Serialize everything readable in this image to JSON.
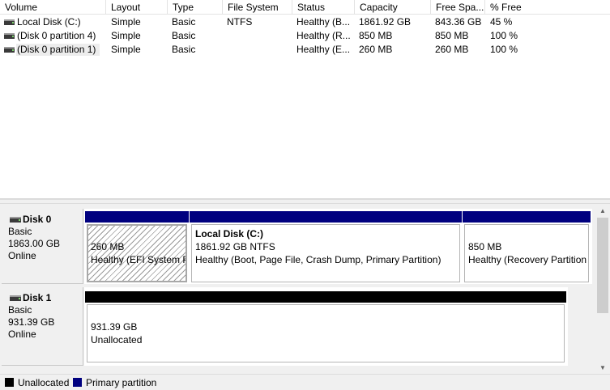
{
  "volume_list": {
    "columns": [
      "Volume",
      "Layout",
      "Type",
      "File System",
      "Status",
      "Capacity",
      "Free Spa...",
      "% Free"
    ],
    "rows": [
      {
        "volume": "Local Disk (C:)",
        "layout": "Simple",
        "type": "Basic",
        "fs": "NTFS",
        "status": "Healthy (B...",
        "capacity": "1861.92 GB",
        "free": "843.36 GB",
        "pct_free": "45 %"
      },
      {
        "volume": "(Disk 0 partition 4)",
        "layout": "Simple",
        "type": "Basic",
        "fs": "",
        "status": "Healthy (R...",
        "capacity": "850 MB",
        "free": "850 MB",
        "pct_free": "100 %"
      },
      {
        "volume": "(Disk 0 partition 1)",
        "layout": "Simple",
        "type": "Basic",
        "fs": "",
        "status": "Healthy (E...",
        "capacity": "260 MB",
        "free": "260 MB",
        "pct_free": "100 %"
      }
    ]
  },
  "disks": [
    {
      "name": "Disk 0",
      "type": "Basic",
      "size": "1863.00 GB",
      "state": "Online",
      "partitions": [
        {
          "title": "",
          "line1": "260 MB",
          "line2": "Healthy (EFI System P"
        },
        {
          "title": "Local Disk  (C:)",
          "line1": "1861.92 GB NTFS",
          "line2": "Healthy (Boot, Page File, Crash Dump, Primary Partition)"
        },
        {
          "title": "",
          "line1": "850 MB",
          "line2": "Healthy (Recovery Partition"
        }
      ]
    },
    {
      "name": "Disk 1",
      "type": "Basic",
      "size": "931.39 GB",
      "state": "Online",
      "partitions": [
        {
          "title": "",
          "line1": "931.39 GB",
          "line2": "Unallocated"
        }
      ]
    }
  ],
  "legend": {
    "unallocated_label": "Unallocated",
    "primary_label": "Primary partition"
  },
  "colors": {
    "primary": "#00007f",
    "unallocated": "#000000"
  },
  "icons": {
    "volume": "drive-icon",
    "disk": "disk-icon",
    "scroll_up": "scroll-up-arrow-icon",
    "scroll_down": "scroll-down-arrow-icon"
  }
}
